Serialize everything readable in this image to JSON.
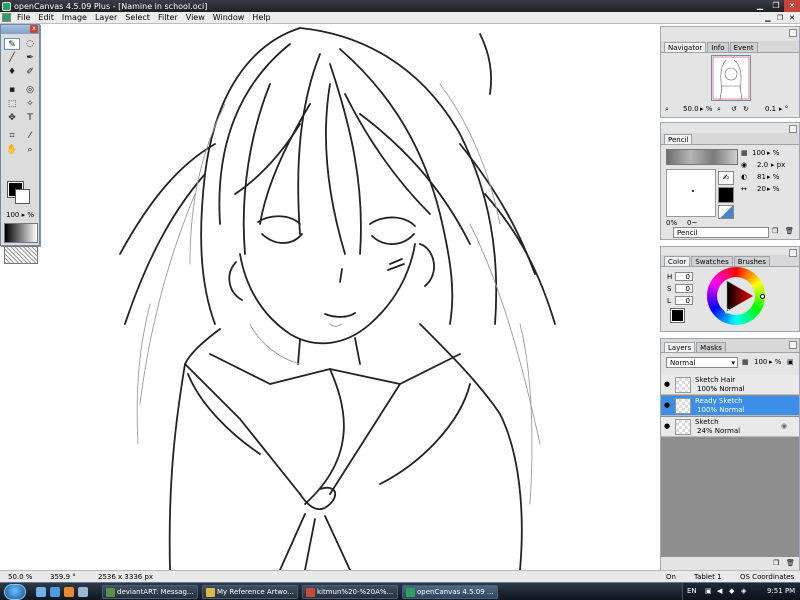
{
  "window": {
    "title": "openCanvas 4.5.09 Plus - [Namine in school.oci]",
    "minimize": "▁",
    "maximize": "❐",
    "close": "✕"
  },
  "menu": {
    "items": [
      "File",
      "Edit",
      "Image",
      "Layer",
      "Select",
      "Filter",
      "View",
      "Window",
      "Help"
    ],
    "doc_minimize": "▁",
    "doc_restore": "❐",
    "doc_close": "✕"
  },
  "tools_palette": {
    "close": "x",
    "zoom_level": "100 ▸ %"
  },
  "navigator": {
    "tabs": [
      "Navigator",
      "Info",
      "Event"
    ],
    "zoom": "50.0",
    "zoom_unit": "▸ %",
    "rotation": "0.1",
    "rotation_unit": "▸ °"
  },
  "pencil": {
    "tab": "Pencil",
    "density": "100",
    "density_unit": "▸ %",
    "size": "2.0",
    "size_unit": "▸ px",
    "hardness": "81",
    "hardness_unit": "▸ %",
    "min_size": "20",
    "min_size_unit": "▸ %",
    "pressure_min": "0%",
    "pressure_curve": "0~",
    "preset_name": "Pencil"
  },
  "color": {
    "tabs": [
      "Color",
      "Swatches",
      "Brushes"
    ],
    "h_label": "H",
    "h_value": "0",
    "s_label": "S",
    "s_value": "0",
    "l_label": "L",
    "l_value": "0"
  },
  "layers": {
    "tabs": [
      "Layers",
      "Masks"
    ],
    "blend_mode": "Normal",
    "opacity": "100",
    "opacity_unit": "▸ %",
    "items": [
      {
        "name": "Sketch Hair",
        "props": "100% Normal",
        "selected": false
      },
      {
        "name": "Ready Sketch",
        "props": "100% Normal",
        "selected": true
      },
      {
        "name": "Sketch",
        "props": "24% Normal",
        "selected": false
      }
    ]
  },
  "statusbar": {
    "zoom": "50.0 %",
    "angle": "359.9 °",
    "size": "2536 x 3336 px",
    "pen_state": "On",
    "tablet": "Tablet 1",
    "coords": "OS Coordinates"
  },
  "taskbar": {
    "buttons": [
      {
        "label": "deviantART: Messag...",
        "color": "#5a8f4e"
      },
      {
        "label": "My Reference Artwo...",
        "color": "#e0b84a"
      },
      {
        "label": "kitmun%20-%20A%...",
        "color": "#c64b3d"
      },
      {
        "label": "openCanvas 4.5.09 ...",
        "color": "#2f9e63"
      }
    ],
    "lang": "EN",
    "time": "9:51 PM"
  },
  "colors": {
    "selection": "#3d8ee6",
    "titlebar": "#2a2d35",
    "panel": "#e4e4e4"
  }
}
